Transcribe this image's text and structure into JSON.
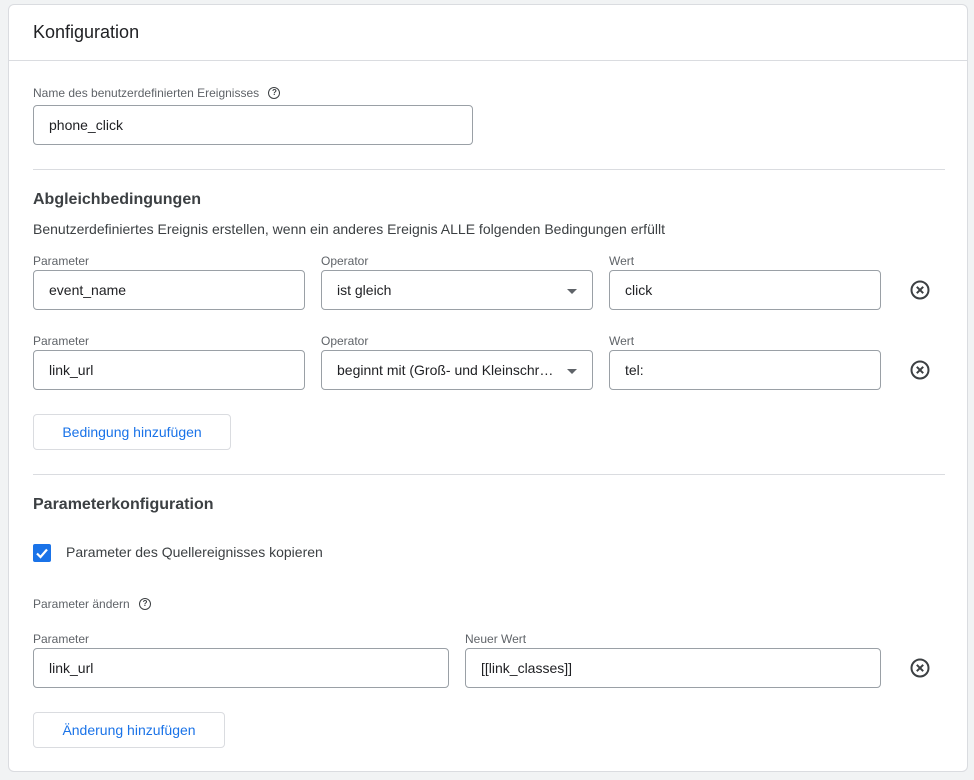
{
  "header": {
    "title": "Konfiguration"
  },
  "event_name": {
    "label": "Name des benutzerdefinierten Ereignisses",
    "value": "phone_click"
  },
  "matching": {
    "title": "Abgleichbedingungen",
    "description": "Benutzerdefiniertes Ereignis erstellen, wenn ein anderes Ereignis ALLE folgenden Bedingungen erfüllt",
    "param_label": "Parameter",
    "operator_label": "Operator",
    "value_label": "Wert",
    "conditions": [
      {
        "parameter": "event_name",
        "operator": "ist gleich",
        "value": "click"
      },
      {
        "parameter": "link_url",
        "operator": "beginnt mit (Groß- und Kleinschreibung wird ignoriert)",
        "value": "tel:"
      }
    ],
    "add_condition_label": "Bedingung hinzufügen"
  },
  "parameters": {
    "title": "Parameterkonfiguration",
    "copy_label": "Parameter des Quellereignisses kopieren",
    "copy_checked": true,
    "modify_label": "Parameter ändern",
    "param_label": "Parameter",
    "new_value_label": "Neuer Wert",
    "modifications": [
      {
        "parameter": "link_url",
        "new_value": "[[link_classes]]"
      }
    ],
    "add_modification_label": "Änderung hinzufügen"
  },
  "colors": {
    "accent": "#1a73e8",
    "border": "#9aa0a6",
    "divider": "#dadce0"
  },
  "icons": {
    "help": "help-circle-icon",
    "remove": "cancel-circle-icon",
    "caret": "caret-down-icon",
    "check": "check-icon"
  }
}
